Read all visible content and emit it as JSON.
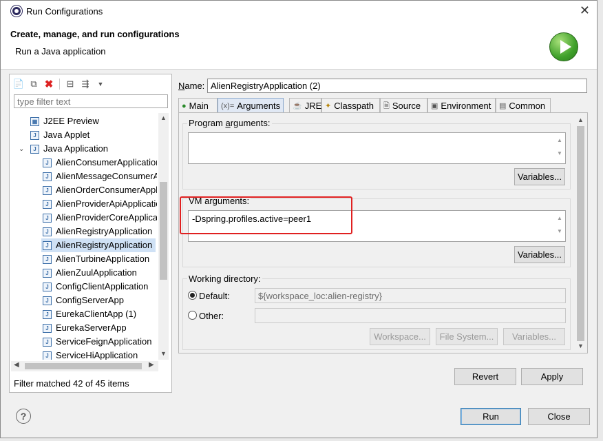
{
  "window": {
    "title": "Run Configurations",
    "close_glyph": "✕"
  },
  "banner": {
    "heading": "Create, manage, and run configurations",
    "subtitle": "Run a Java application"
  },
  "left": {
    "filter_placeholder": "type filter text",
    "tree": [
      {
        "label": "J2EE Preview",
        "indent": 1
      },
      {
        "label": "Java Applet",
        "indent": 1
      },
      {
        "label": "Java Application",
        "indent": 1,
        "expanded": true
      },
      {
        "label": "AlienConsumerApplication",
        "indent": 2
      },
      {
        "label": "AlienMessageConsumerApplication",
        "indent": 2
      },
      {
        "label": "AlienOrderConsumerApplication",
        "indent": 2
      },
      {
        "label": "AlienProviderApiApplication",
        "indent": 2
      },
      {
        "label": "AlienProviderCoreApplication",
        "indent": 2
      },
      {
        "label": "AlienRegistryApplication",
        "indent": 2
      },
      {
        "label": "AlienRegistryApplication",
        "indent": 2,
        "selected": true
      },
      {
        "label": "AlienTurbineApplication",
        "indent": 2
      },
      {
        "label": "AlienZuulApplication",
        "indent": 2
      },
      {
        "label": "ConfigClientApplication",
        "indent": 2
      },
      {
        "label": "ConfigServerApp",
        "indent": 2
      },
      {
        "label": "EurekaClientApp (1)",
        "indent": 2
      },
      {
        "label": "EurekaServerApp",
        "indent": 2
      },
      {
        "label": "ServiceFeignApplication",
        "indent": 2
      },
      {
        "label": "ServiceHiApplication",
        "indent": 2
      }
    ],
    "status": "Filter matched 42 of 45 items"
  },
  "config": {
    "name_label": "Name:",
    "name_value": "AlienRegistryApplication (2)",
    "tabs": [
      "Main",
      "Arguments",
      "JRE",
      "Classpath",
      "Source",
      "Environment",
      "Common"
    ],
    "active_tab": "Arguments",
    "program_args_label": "Program arguments:",
    "program_args_value": "",
    "variables_label": "Variables...",
    "vm_args_label": "VM arguments:",
    "vm_args_value": "-Dspring.profiles.active=peer1",
    "working_dir_label": "Working directory:",
    "default_label": "Default:",
    "default_value": "${workspace_loc:alien-registry}",
    "other_label": "Other:",
    "workspace_btn": "Workspace...",
    "filesystem_btn": "File System...",
    "revert_btn": "Revert",
    "apply_btn": "Apply"
  },
  "footer": {
    "run_btn": "Run",
    "close_btn": "Close",
    "help_glyph": "?"
  },
  "colors": {
    "highlight": "#e02020",
    "selection": "#cfe1f5",
    "run_icon": "#3fa02a"
  }
}
